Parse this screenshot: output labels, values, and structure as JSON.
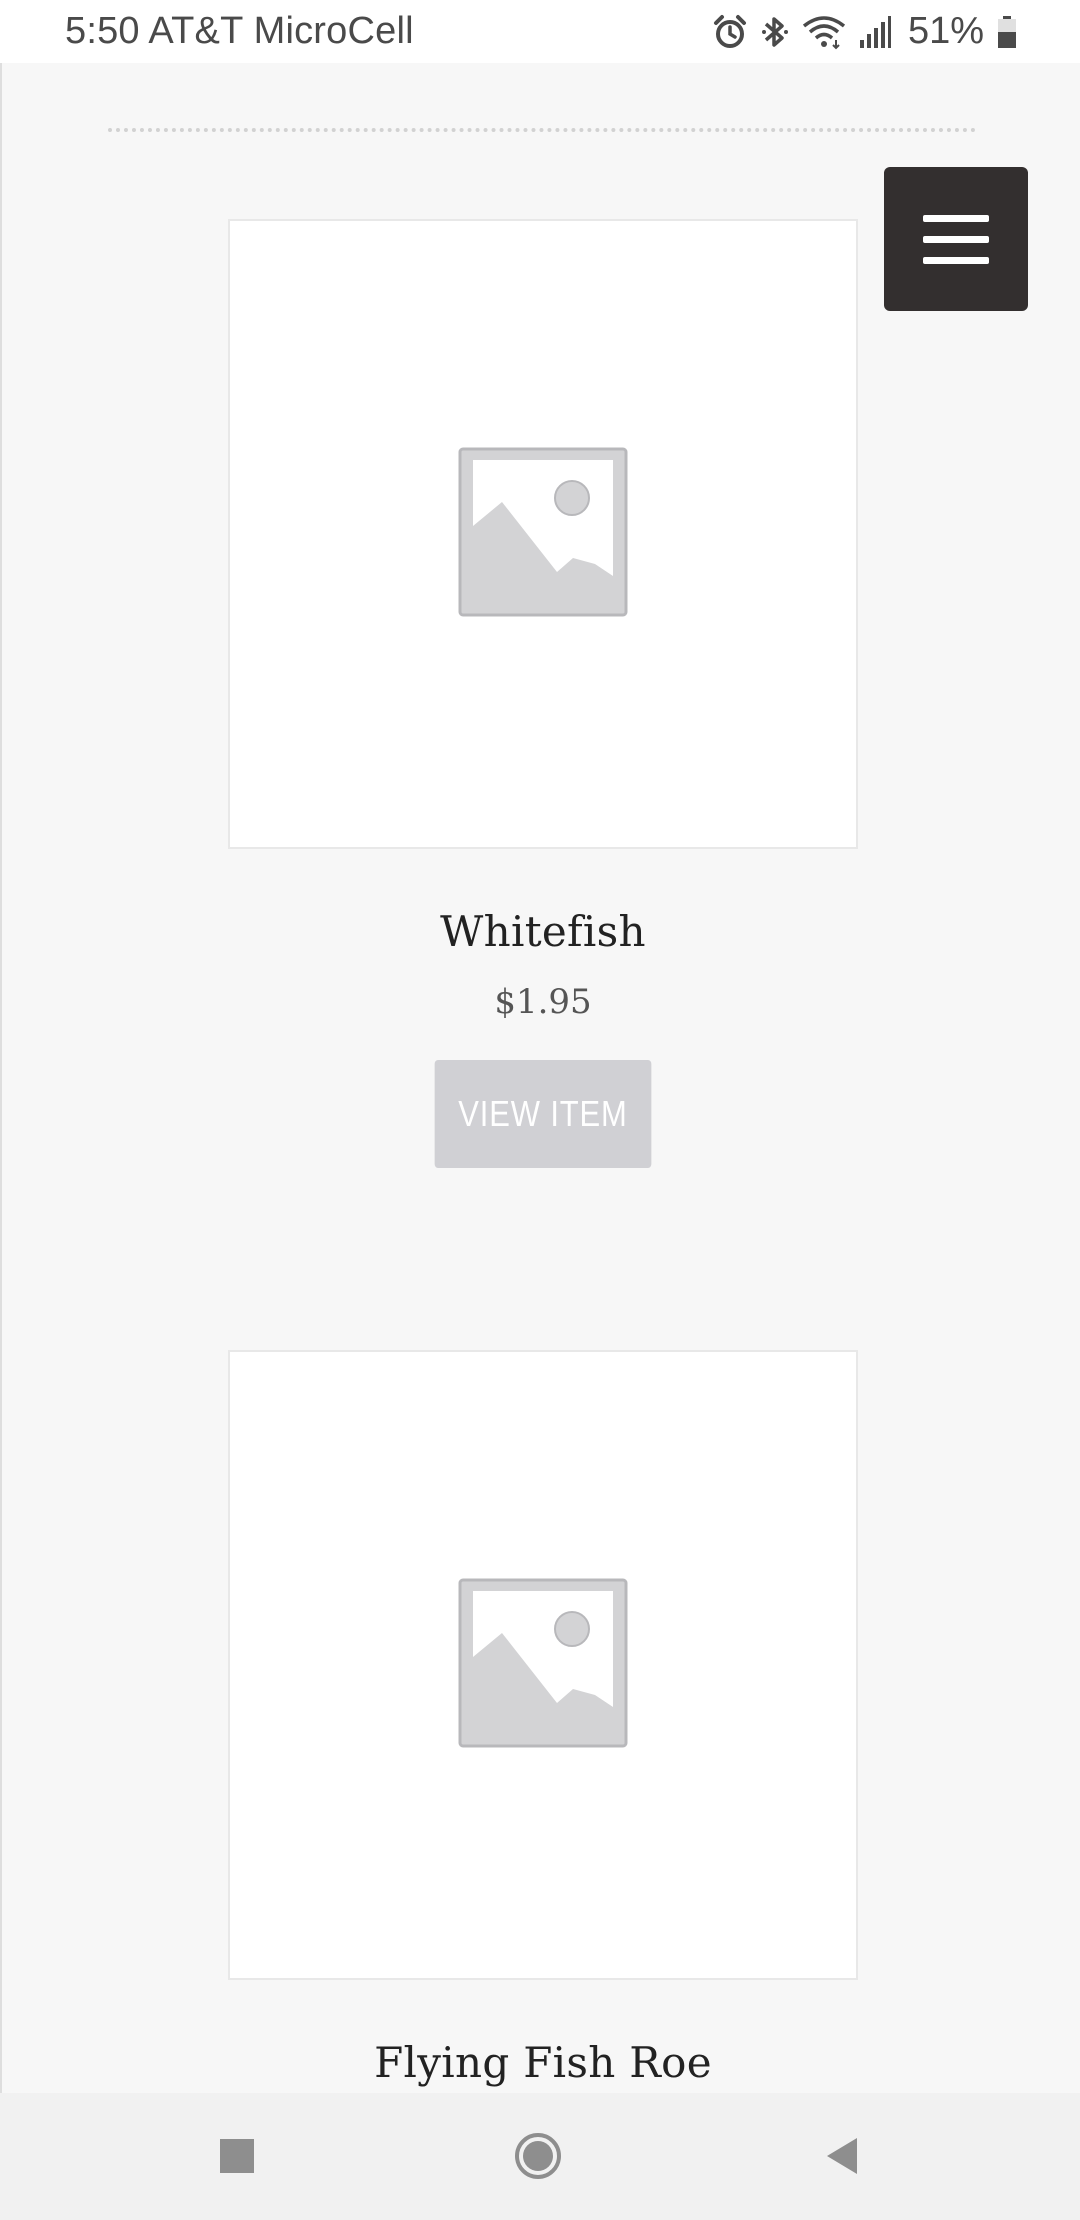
{
  "status_bar": {
    "carrier_time": "5:50 AT&T MicroCell",
    "battery_percent": "51%",
    "icons": [
      "alarm-icon",
      "bluetooth-icon",
      "wifi-icon",
      "signal-icon",
      "battery-icon"
    ]
  },
  "header": {
    "menu_icon": "hamburger-menu-icon",
    "menu_color": "#332f2f"
  },
  "products": [
    {
      "title": "Whitefish",
      "price": "$1.95",
      "button_label": "VIEW ITEM",
      "image_icon": "image-placeholder-icon"
    },
    {
      "title": "Flying Fish Roe",
      "image_icon": "image-placeholder-icon"
    }
  ],
  "nav_bar": {
    "icons": [
      "recents-icon",
      "home-icon",
      "back-icon"
    ]
  },
  "colors": {
    "page_background": "#f7f7f7",
    "button_background": "#d0d0d4",
    "placeholder_gray": "#d3d3d5"
  }
}
